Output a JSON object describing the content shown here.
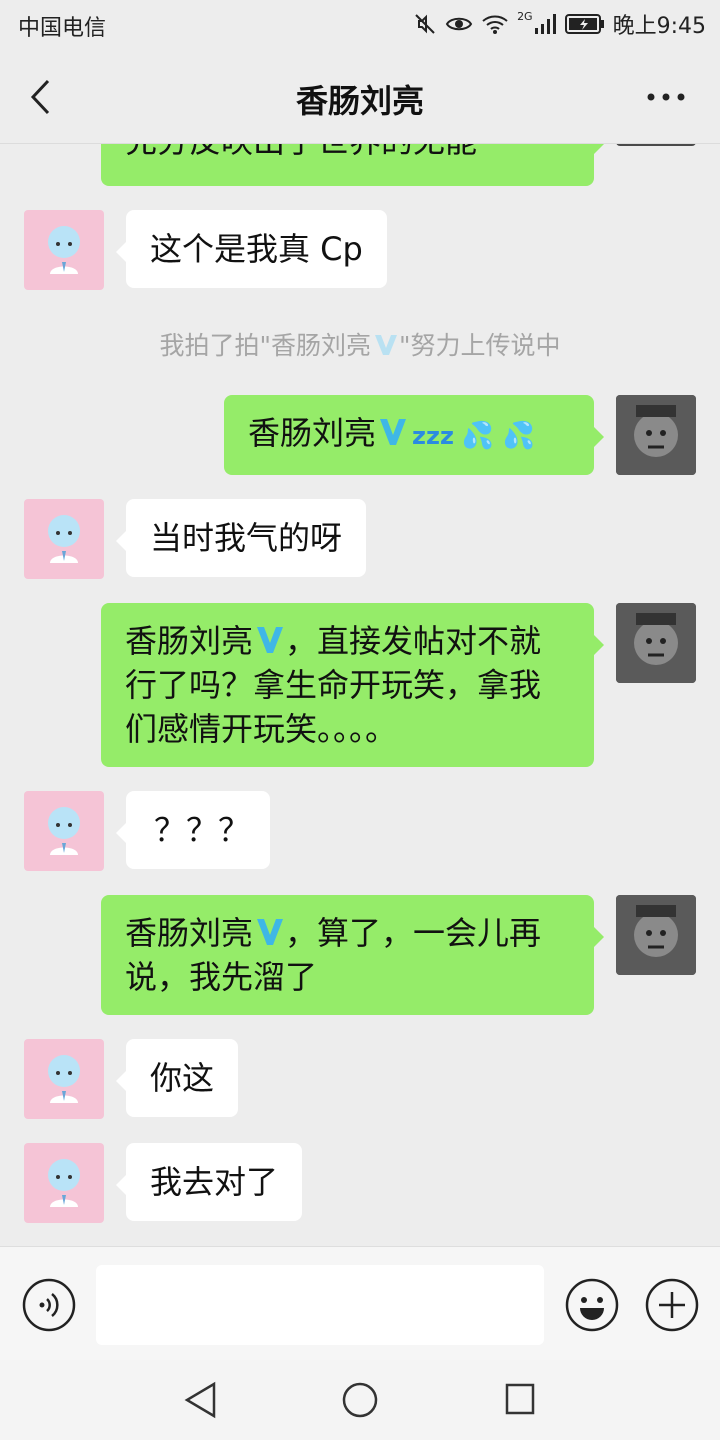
{
  "status_bar": {
    "carrier": "中国电信",
    "network": "2G",
    "time": "晚上9:45"
  },
  "header": {
    "title": "香肠刘亮",
    "back_icon": "chevron-left-icon",
    "more_icon": "more-dots-icon"
  },
  "messages": [
    {
      "side": "right",
      "text": "充分反映出了世界的无能"
    },
    {
      "side": "left",
      "text": "这个是我真 Cp"
    },
    {
      "side": "system",
      "text_before": "我拍了拍\"香肠刘亮",
      "text_after": "\"努力上传说中"
    },
    {
      "side": "right",
      "name": "香肠刘亮",
      "emoji_zzz": "zzz",
      "emoji_sweat": "💦 💦"
    },
    {
      "side": "left",
      "text": "当时我气的呀"
    },
    {
      "side": "right",
      "name": "香肠刘亮",
      "line1": "，直接发帖对不就",
      "line2": "行了吗？拿生命开玩笑，拿我",
      "line3": "们感情开玩笑。。。。"
    },
    {
      "side": "left",
      "text": "？？？"
    },
    {
      "side": "right",
      "name": "香肠刘亮",
      "line1": "，算了，一会儿再",
      "line2": "说，我先溜了"
    },
    {
      "side": "left",
      "text": "你这"
    },
    {
      "side": "left",
      "text": "我去对了"
    }
  ],
  "input_bar": {
    "placeholder": "",
    "voice_icon": "voice-icon",
    "emoji_icon": "emoji-icon",
    "plus_icon": "plus-icon"
  },
  "colors": {
    "background": "#ededed",
    "sent_bubble": "#95ec69",
    "received_bubble": "#ffffff",
    "verified_badge": "#7cc7e8"
  }
}
